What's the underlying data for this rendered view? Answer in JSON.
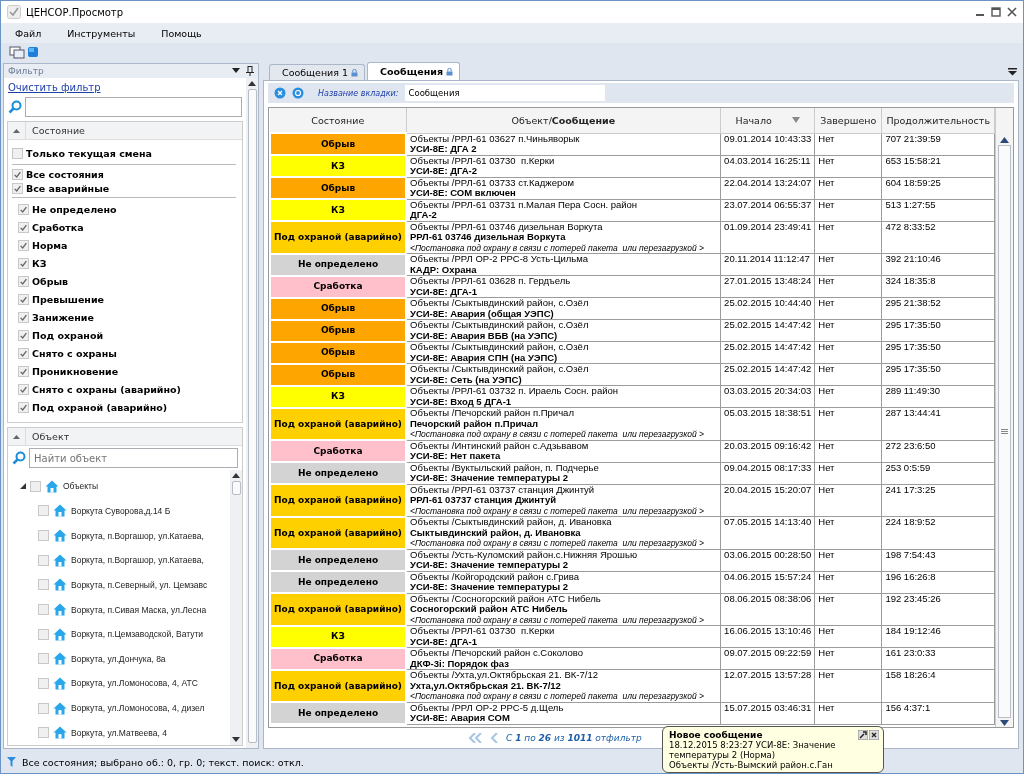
{
  "window": {
    "title": "ЦЕНСОР.Просмотр"
  },
  "menu": [
    "Файл",
    "Инструменты",
    "Помощь"
  ],
  "filter_panel": {
    "title": "Фильтр",
    "clear_link": "Очистить фильтр",
    "state_section": {
      "title": "Состояние",
      "expanded": true,
      "options": [
        {
          "label": "Только текущая смена",
          "checked": false,
          "kind": "top"
        },
        {
          "label": "Все состояния",
          "checked": true,
          "kind": "group"
        },
        {
          "label": "Все аварийные",
          "checked": true,
          "kind": "group"
        },
        {
          "label": "Не определено",
          "checked": true,
          "kind": "item"
        },
        {
          "label": "Сработка",
          "checked": true,
          "kind": "item"
        },
        {
          "label": "Норма",
          "checked": true,
          "kind": "item"
        },
        {
          "label": "КЗ",
          "checked": true,
          "kind": "item"
        },
        {
          "label": "Обрыв",
          "checked": true,
          "kind": "item"
        },
        {
          "label": "Превышение",
          "checked": true,
          "kind": "item"
        },
        {
          "label": "Занижение",
          "checked": true,
          "kind": "item"
        },
        {
          "label": "Под охраной",
          "checked": true,
          "kind": "item"
        },
        {
          "label": "Снято с охраны",
          "checked": true,
          "kind": "item"
        },
        {
          "label": "Проникновение",
          "checked": true,
          "kind": "item"
        },
        {
          "label": "Снято с охраны (аварийно)",
          "checked": true,
          "kind": "item"
        },
        {
          "label": "Под охраной (аварийно)",
          "checked": true,
          "kind": "item"
        }
      ]
    },
    "object_section": {
      "title": "Объект",
      "expanded": true,
      "search": {
        "placeholder": "Найти объект"
      },
      "tree": [
        {
          "label": "Объекты",
          "expanded": true,
          "checked": false,
          "children": [
            {
              "label": "Воркута Суворова,д.14 Б",
              "checked": false
            },
            {
              "label": "Воркута, п.Воргашор, ул.Катаева,",
              "checked": false
            },
            {
              "label": "Воркута, п.Воргашор, ул.Катаева,",
              "checked": false
            },
            {
              "label": "Воркута, п.Северный, ул. Цемзавс",
              "checked": false
            },
            {
              "label": "Воркута, п.Сивая Маска, ул.Лесна",
              "checked": false
            },
            {
              "label": "Воркута, п.Цемзаводской, Ватути",
              "checked": false
            },
            {
              "label": "Воркута, ул.Дончука, 8а",
              "checked": false
            },
            {
              "label": "Воркута, ул.Ломоносова, 4, АТС",
              "checked": false
            },
            {
              "label": "Воркута, ул.Ломоносова, 4, дизел",
              "checked": false
            },
            {
              "label": "Воркута, ул.Матвеева, 4",
              "checked": false
            }
          ]
        }
      ]
    }
  },
  "tabs": [
    {
      "label": "Сообщения 1",
      "selected": false
    },
    {
      "label": "Сообщения",
      "selected": true
    }
  ],
  "tab_toolbar": {
    "label": "Название вкладки:",
    "value": "Сообщения"
  },
  "table": {
    "columns": [
      {
        "label": "Состояние",
        "sorted": false
      },
      {
        "label": "Объект/**Сообщение**",
        "sorted": false
      },
      {
        "label": "Начало",
        "sorted": true
      },
      {
        "label": "Завершено",
        "sorted": false
      },
      {
        "label": "Продолжительность",
        "sorted": false
      }
    ],
    "rows": [
      {
        "state": "Обрыв",
        "color": "#ffa500",
        "object": "Объекты /РРЛ-61 03627 п.Чиньяворык",
        "message": "УСИ-8Е: ДГА 2",
        "start": "09.01.2014 10:43:33",
        "finished": "Нет",
        "duration": "707 21:39:59"
      },
      {
        "state": "КЗ",
        "color": "#ffff00",
        "object": "Объекты /РРЛ-61 03730  п.Керки",
        "message": "УСИ-8Е: ДГА-2",
        "start": "04.03.2014 16:25:11",
        "finished": "Нет",
        "duration": "653 15:58:21"
      },
      {
        "state": "Обрыв",
        "color": "#ffa500",
        "object": "Объекты /РРЛ-61 03733 ст.Каджером",
        "message": "УСИ-8Е: СОМ включен",
        "start": "22.04.2014 13:24:07",
        "finished": "Нет",
        "duration": "604 18:59:25"
      },
      {
        "state": "КЗ",
        "color": "#ffff00",
        "object": "Объекты /РРЛ-61 03731 п.Малая Пера Сосн. район",
        "message": "ДГА-2",
        "start": "23.07.2014 06:55:37",
        "finished": "Нет",
        "duration": "513 1:27:55"
      },
      {
        "state": "Под охраной (аварийно)",
        "color": "#ffd000",
        "object": "Объекты /РРЛ-61 03746 дизельная Воркута",
        "message": "РРЛ-61 03746 дизельная Воркута",
        "note": "<Постановка под охрану в связи с потерей пакета  или перезагрузкой >",
        "start": "01.09.2014 23:49:41",
        "finished": "Нет",
        "duration": "472 8:33:52"
      },
      {
        "state": "Не определено",
        "color": "#d3d3d3",
        "object": "Объекты /РРЛ ОР-2 РРС-8 Усть-Цильма",
        "message": "КАДР: Охрана",
        "start": "20.11.2014 11:12:47",
        "finished": "Нет",
        "duration": "392 21:10:46"
      },
      {
        "state": "Сработка",
        "color": "#ffc0cb",
        "object": "Объекты /РРЛ-61 03628 п. Гердъель",
        "message": "УСИ-8Е: ДГА-1",
        "start": "27.01.2015 13:48:24",
        "finished": "Нет",
        "duration": "324 18:35:8"
      },
      {
        "state": "Обрыв",
        "color": "#ffa500",
        "object": "Объекты /Сыктывдинский район, с.Озёл",
        "message": "УСИ-8Е: Авария (общая УЭПС)",
        "start": "25.02.2015 10:44:40",
        "finished": "Нет",
        "duration": "295 21:38:52"
      },
      {
        "state": "Обрыв",
        "color": "#ffa500",
        "object": "Объекты /Сыктывдинский район, с.Озёл",
        "message": "УСИ-8Е: Авария ВБВ (на УЭПС)",
        "start": "25.02.2015 14:47:42",
        "finished": "Нет",
        "duration": "295 17:35:50"
      },
      {
        "state": "Обрыв",
        "color": "#ffa500",
        "object": "Объекты /Сыктывдинский район, с.Озёл",
        "message": "УСИ-8Е: Авария СПН (на УЭПС)",
        "start": "25.02.2015 14:47:42",
        "finished": "Нет",
        "duration": "295 17:35:50"
      },
      {
        "state": "Обрыв",
        "color": "#ffa500",
        "object": "Объекты /Сыктывдинский район, с.Озёл",
        "message": "УСИ-8Е: Сеть (на УЭПС)",
        "start": "25.02.2015 14:47:42",
        "finished": "Нет",
        "duration": "295 17:35:50"
      },
      {
        "state": "КЗ",
        "color": "#ffff00",
        "object": "Объекты /РРЛ-61 03732 п. Ираель Сосн. район",
        "message": "УСИ-8Е: Вход 5 ДГА-1",
        "start": "03.03.2015 20:34:03",
        "finished": "Нет",
        "duration": "289 11:49:30"
      },
      {
        "state": "Под охраной (аварийно)",
        "color": "#ffd000",
        "object": "Объекты /Печорский район п.Причал",
        "message": "Печорский район п.Причал",
        "note": "<Постановка под охрану в связи с потерей пакета  или перезагрузкой >",
        "start": "05.03.2015 18:38:51",
        "finished": "Нет",
        "duration": "287 13:44:41"
      },
      {
        "state": "Сработка",
        "color": "#ffc0cb",
        "object": "Объекты /Интинский район с.Адзьвавом",
        "message": "УСИ-8Е: Нет пакета",
        "start": "20.03.2015 09:16:42",
        "finished": "Нет",
        "duration": "272 23:6:50"
      },
      {
        "state": "Не определено",
        "color": "#d3d3d3",
        "object": "Объекты /Вуктыльский район, п. Подчерье",
        "message": "УСИ-8Е: Значение температуры 2",
        "start": "09.04.2015 08:17:33",
        "finished": "Нет",
        "duration": "253 0:5:59"
      },
      {
        "state": "Под охраной (аварийно)",
        "color": "#ffd000",
        "object": "Объекты /РРЛ-61 03737 станция Джинтуй",
        "message": "РРЛ-61 03737 станция Джинтуй",
        "note": "<Постановка под охрану в связи с потерей пакета  или перезагрузкой >",
        "start": "20.04.2015 15:20:07",
        "finished": "Нет",
        "duration": "241 17:3:25"
      },
      {
        "state": "Под охраной (аварийно)",
        "color": "#ffd000",
        "object": "Объекты /Сыктывдинский район, д. Ивановка",
        "message": "Сыктывдинский район, д. Ивановка",
        "note": "<Постановка под охрану в связи с потерей пакета  или перезагрузкой >",
        "start": "07.05.2015 14:13:40",
        "finished": "Нет",
        "duration": "224 18:9:52"
      },
      {
        "state": "Не определено",
        "color": "#d3d3d3",
        "object": "Объекты /Усть-Куломский район.с.Нижняя Ярошью",
        "message": "УСИ-8Е: Значение температуры 2",
        "start": "03.06.2015 00:28:50",
        "finished": "Нет",
        "duration": "198 7:54:43"
      },
      {
        "state": "Не определено",
        "color": "#d3d3d3",
        "object": "Объекты /Койгородский район с.Грива",
        "message": "УСИ-8Е: Значение температуры 2",
        "start": "04.06.2015 15:57:24",
        "finished": "Нет",
        "duration": "196 16:26:8"
      },
      {
        "state": "Под охраной (аварийно)",
        "color": "#ffd000",
        "object": "Объекты /Сосногорский район АТС Нибель",
        "message": "Сосногорский район АТС Нибель",
        "note": "<Постановка под охрану в связи с потерей пакета  или перезагрузкой >",
        "start": "08.06.2015 08:38:06",
        "finished": "Нет",
        "duration": "192 23:45:26"
      },
      {
        "state": "КЗ",
        "color": "#ffff00",
        "object": "Объекты /РРЛ-61 03730  п.Керки",
        "message": "УСИ-8Е: ДГА-1",
        "start": "16.06.2015 13:10:46",
        "finished": "Нет",
        "duration": "184 19:12:46"
      },
      {
        "state": "Сработка",
        "color": "#ffc0cb",
        "object": "Объекты /Печорский район с.Соколово",
        "message": "ДКФ-3i: Порядок фаз",
        "start": "09.07.2015 09:22:59",
        "finished": "Нет",
        "duration": "161 23:0:33"
      },
      {
        "state": "Под охраной (аварийно)",
        "color": "#ffd000",
        "object": "Объекты /Ухта,ул.Октябрьская 21. ВК-7/12",
        "message": "Ухта,ул.Октябрьская 21. ВК-7/12",
        "note": "<Постановка под охрану в связи с потерей пакета  или перезагрузкой >",
        "start": "12.07.2015 13:57:28",
        "finished": "Нет",
        "duration": "158 18:26:4"
      },
      {
        "state": "Не определено",
        "color": "#d3d3d3",
        "object": "Объекты /РРЛ ОР-2 РРС-5 д.Щель",
        "message": "УСИ-8Е: Авария СОМ",
        "start": "15.07.2015 03:46:31",
        "finished": "Нет",
        "duration": "156 4:37:1"
      }
    ]
  },
  "pager": {
    "text": "С **1** по **26** из **1011** отфильтр"
  },
  "notification": {
    "title": "Новое сообщение",
    "message": "18.12.2015 8:23:27 УСИ-8Е: Значение температуры 2 (Норма)",
    "object": "Объекты /Усть-Вымский район.с.Ган"
  },
  "status_bar": {
    "text": "Все состояния; выбрано об.: 0, гр. 0; текст. поиск: откл."
  }
}
